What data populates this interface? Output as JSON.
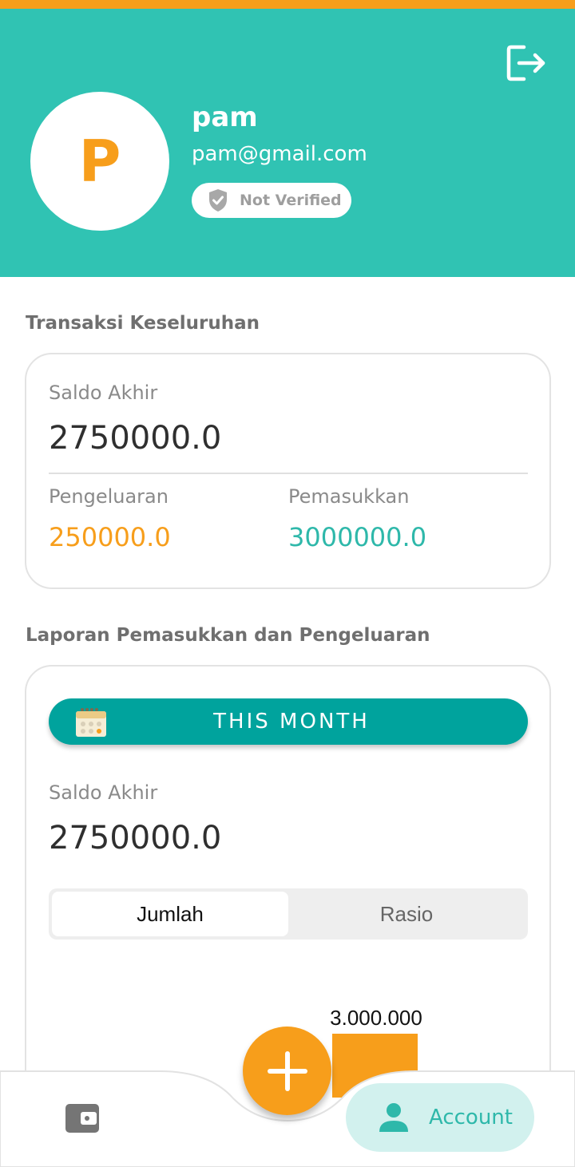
{
  "profile": {
    "initial": "P",
    "name": "pam",
    "email": "pam@gmail.com",
    "verification_status": "Not Verified"
  },
  "overall": {
    "section_title": "Transaksi Keseluruhan",
    "balance_label": "Saldo Akhir",
    "balance_value": "2750000.0",
    "expense_label": "Pengeluaran",
    "expense_value": "250000.0",
    "income_label": "Pemasukkan",
    "income_value": "3000000.0"
  },
  "report": {
    "section_title": "Laporan Pemasukkan dan Pengeluaran",
    "period_button": "THIS MONTH",
    "balance_label": "Saldo Akhir",
    "balance_value": "2750000.0",
    "tabs": [
      {
        "label": "Jumlah",
        "active": true
      },
      {
        "label": "Rasio",
        "active": false
      }
    ],
    "chart_bar_label": "3.000.000"
  },
  "chart_data": {
    "type": "bar",
    "values": [
      3000000
    ],
    "data_labels": [
      "3.000.000"
    ],
    "colors": [
      "#F79E1B"
    ]
  },
  "bottom_nav": {
    "account_label": "Account"
  },
  "colors": {
    "header": "#30C3B3",
    "accent_orange": "#F79E1B",
    "accent_teal": "#2EB8AA",
    "button_teal": "#00A39D"
  },
  "icons": {
    "logout": "logout-icon",
    "shield": "shield-check-icon",
    "calendar": "calendar-icon",
    "wallet": "wallet-icon",
    "add": "plus-icon",
    "person": "person-icon"
  }
}
